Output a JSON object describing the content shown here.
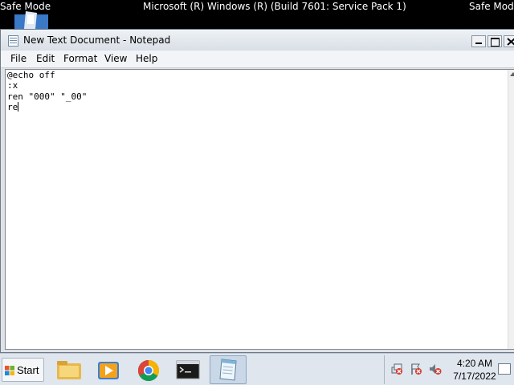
{
  "safe_mode": {
    "left": "Safe Mode",
    "center": "Microsoft (R) Windows (R) (Build 7601: Service Pack 1)",
    "right": "Safe Mode"
  },
  "notepad": {
    "title": "New Text Document - Notepad",
    "menu": [
      "File",
      "Edit",
      "Format",
      "View",
      "Help"
    ],
    "lines": [
      "@echo off",
      ":x",
      "ren \"000\" \"_00\"",
      "re"
    ]
  },
  "taskbar": {
    "start_label": "Start",
    "pinned": [
      "file-explorer-icon",
      "media-player-icon",
      "chrome-icon",
      "command-prompt-icon",
      "notepad-icon"
    ],
    "tray": [
      "network-icon",
      "flag-icon",
      "volume-icon"
    ],
    "clock_time": "4:20 AM",
    "clock_date": "7/17/2022"
  },
  "colors": {
    "desktop": "#000000",
    "titlebar": "#e6ebf0",
    "taskbar": "#dfe6ee"
  }
}
